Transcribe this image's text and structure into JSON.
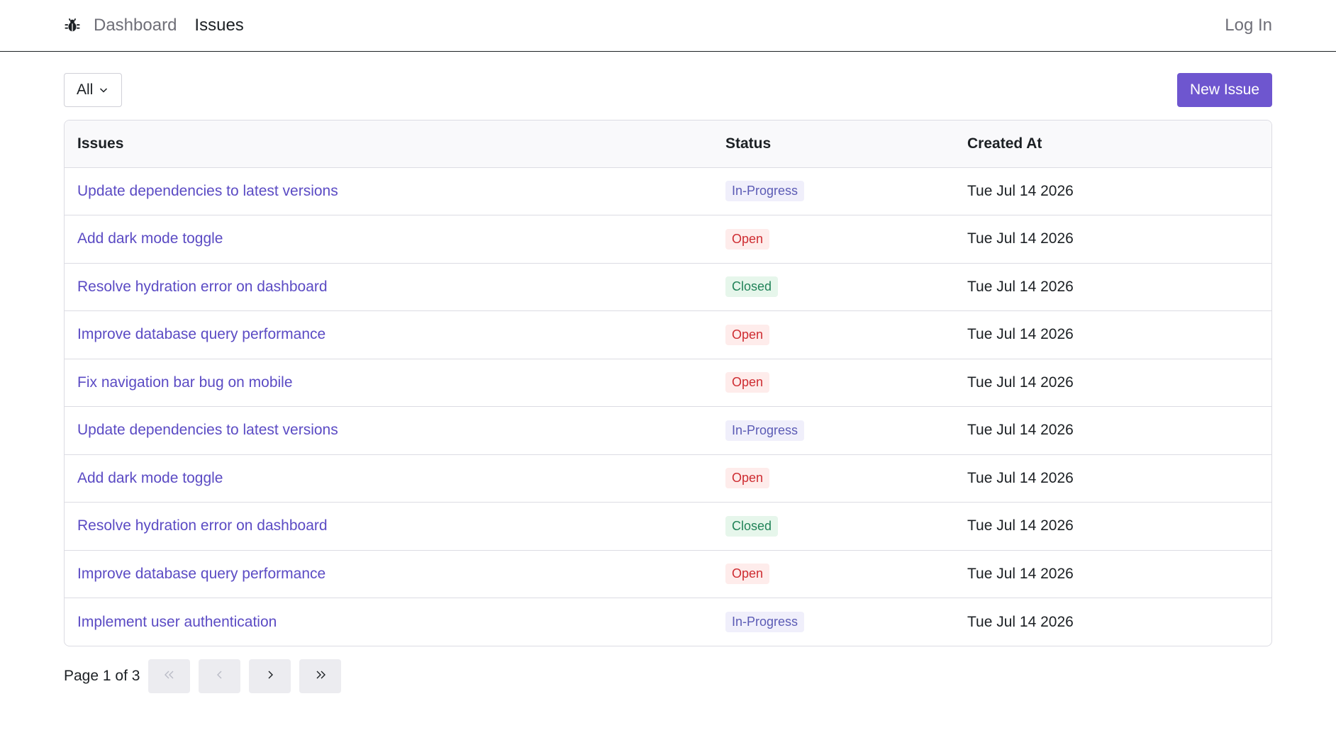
{
  "nav": {
    "logo_icon": "bug-icon",
    "links": [
      {
        "label": "Dashboard",
        "active": false
      },
      {
        "label": "Issues",
        "active": true
      }
    ],
    "login_label": "Log In"
  },
  "toolbar": {
    "filter_value": "All",
    "new_issue_label": "New Issue",
    "accent_color": "#6e56cf"
  },
  "table": {
    "headers": {
      "issue": "Issues",
      "status": "Status",
      "created": "Created At"
    },
    "rows": [
      {
        "title": "Update dependencies to latest versions",
        "status": "In-Progress",
        "created": "Tue Jul 14 2026"
      },
      {
        "title": "Add dark mode toggle",
        "status": "Open",
        "created": "Tue Jul 14 2026"
      },
      {
        "title": "Resolve hydration error on dashboard",
        "status": "Closed",
        "created": "Tue Jul 14 2026"
      },
      {
        "title": "Improve database query performance",
        "status": "Open",
        "created": "Tue Jul 14 2026"
      },
      {
        "title": "Fix navigation bar bug on mobile",
        "status": "Open",
        "created": "Tue Jul 14 2026"
      },
      {
        "title": "Update dependencies to latest versions",
        "status": "In-Progress",
        "created": "Tue Jul 14 2026"
      },
      {
        "title": "Add dark mode toggle",
        "status": "Open",
        "created": "Tue Jul 14 2026"
      },
      {
        "title": "Resolve hydration error on dashboard",
        "status": "Closed",
        "created": "Tue Jul 14 2026"
      },
      {
        "title": "Improve database query performance",
        "status": "Open",
        "created": "Tue Jul 14 2026"
      },
      {
        "title": "Implement user authentication",
        "status": "In-Progress",
        "created": "Tue Jul 14 2026"
      }
    ]
  },
  "pagination": {
    "label": "Page 1 of 3",
    "buttons": [
      "first-page-icon",
      "previous-page-icon",
      "next-page-icon",
      "last-page-icon"
    ]
  },
  "status_colors": {
    "In-Progress": "#5b5bb5",
    "Open": "#ce2c31",
    "Closed": "#218358"
  }
}
